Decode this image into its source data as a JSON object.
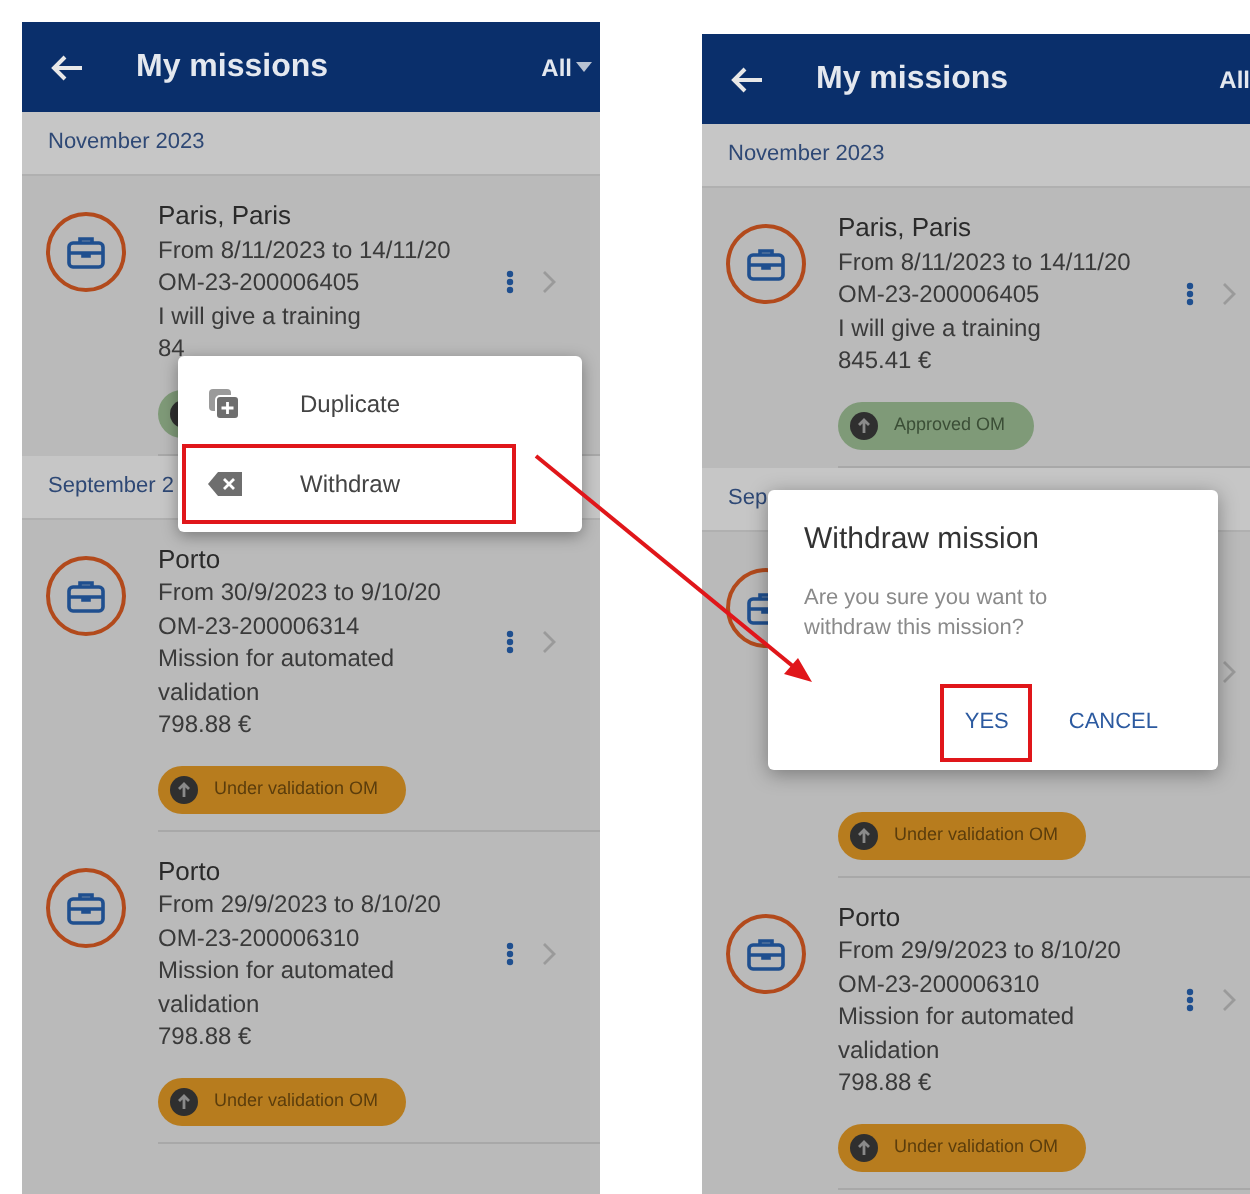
{
  "screens": [
    {
      "header": {
        "title": "My missions",
        "filter": "All",
        "dropdown": true
      },
      "sections": [
        {
          "label": "November 2023",
          "missions": [
            {
              "place": "Paris, Paris",
              "dates": "From 8/11/2023 to 14/11/20",
              "reference": "OM-23-200006405",
              "purpose": "I will give a training",
              "amount": "84",
              "status": {
                "kind": "approved"
              }
            }
          ]
        },
        {
          "label": "September 2",
          "missions": [
            {
              "place": "Porto",
              "dates": "From 30/9/2023 to 9/10/20",
              "reference": "OM-23-200006314",
              "purpose": "Mission for automated validation",
              "amount": "798.88 €",
              "status": {
                "kind": "under_validation",
                "label": "Under validation OM"
              }
            },
            {
              "place": "Porto",
              "dates": "From 29/9/2023 to 8/10/20",
              "reference": "OM-23-200006310",
              "purpose": "Mission for automated validation",
              "amount": "798.88 €",
              "status": {
                "kind": "under_validation",
                "label": "Under validation OM"
              }
            }
          ]
        }
      ],
      "menu": {
        "items": [
          {
            "label": "Duplicate",
            "kind": "duplicate",
            "highlighted": false
          },
          {
            "label": "Withdraw",
            "kind": "withdraw",
            "highlighted": true
          }
        ]
      }
    },
    {
      "header": {
        "title": "My missions",
        "filter": "All",
        "dropdown": false
      },
      "sections": [
        {
          "label": "November 2023",
          "missions": [
            {
              "place": "Paris, Paris",
              "dates": "From 8/11/2023 to 14/11/20",
              "reference": "OM-23-200006405",
              "purpose": "I will give a training",
              "amount": "845.41 €",
              "status": {
                "kind": "approved",
                "label": "Approved OM"
              }
            }
          ]
        },
        {
          "label": "Sep",
          "missions": [
            {
              "status": {
                "kind": "under_validation",
                "label": "Under validation OM"
              }
            },
            {
              "place": "Porto",
              "dates": "From 29/9/2023 to 8/10/20",
              "reference": "OM-23-200006310",
              "purpose": "Mission for automated validation",
              "amount": "798.88 €",
              "status": {
                "kind": "under_validation",
                "label": "Under validation OM"
              }
            }
          ]
        }
      ],
      "dialog": {
        "title": "Withdraw mission",
        "message": "Are you sure you want to withdraw this mission?",
        "actions": [
          {
            "label": "YES",
            "highlighted": true
          },
          {
            "label": "CANCEL",
            "highlighted": false
          }
        ]
      }
    }
  ]
}
